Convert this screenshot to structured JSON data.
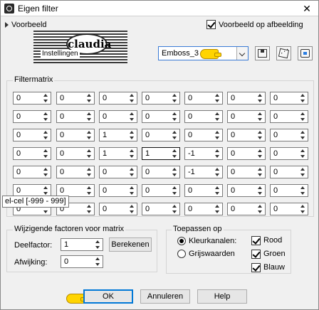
{
  "window": {
    "title": "Eigen filter"
  },
  "preview": {
    "toggle_label": "Voorbeeld",
    "show_on_image_label": "Voorbeeld op afbeelding",
    "show_on_image_checked": true,
    "logo_badge_text": "claudia",
    "logo_caption": "Instellingen"
  },
  "preset": {
    "selected": "Emboss_3",
    "tools": [
      "save-preset-icon",
      "randomize-icon",
      "reset-icon"
    ]
  },
  "matrix": {
    "title": "Filtermatrix",
    "rows": [
      [
        "0",
        "0",
        "0",
        "0",
        "0",
        "0",
        "0"
      ],
      [
        "0",
        "0",
        "0",
        "0",
        "0",
        "0",
        "0"
      ],
      [
        "0",
        "0",
        "1",
        "0",
        "0",
        "0",
        "0"
      ],
      [
        "0",
        "0",
        "1",
        "1",
        "-1",
        "0",
        "0"
      ],
      [
        "0",
        "0",
        "0",
        "0",
        "-1",
        "0",
        "0"
      ],
      [
        "0",
        "0",
        "0",
        "0",
        "0",
        "0",
        "0"
      ],
      [
        "0",
        "0",
        "0",
        "0",
        "0",
        "0",
        "0"
      ]
    ],
    "tooltip": "el-cel [-999 - 999]"
  },
  "factors": {
    "title": "Wijzigende factoren voor matrix",
    "divisor_label": "Deelfactor:",
    "divisor_value": "1",
    "compute_button": "Berekenen",
    "bias_label": "Afwijking:",
    "bias_value": "0"
  },
  "apply": {
    "title": "Toepassen op",
    "color_channels_label": "Kleurkanalen:",
    "grayscale_label": "Grijswaarden",
    "selected_mode": "color_channels",
    "channels": [
      {
        "label": "Rood",
        "checked": true
      },
      {
        "label": "Groen",
        "checked": true
      },
      {
        "label": "Blauw",
        "checked": true
      }
    ]
  },
  "footer": {
    "ok": "OK",
    "cancel": "Annuleren",
    "help": "Help"
  },
  "colors": {
    "accent": "#0078d7",
    "pointer": "#ffd400",
    "window_bg": "#f0f0f0"
  }
}
